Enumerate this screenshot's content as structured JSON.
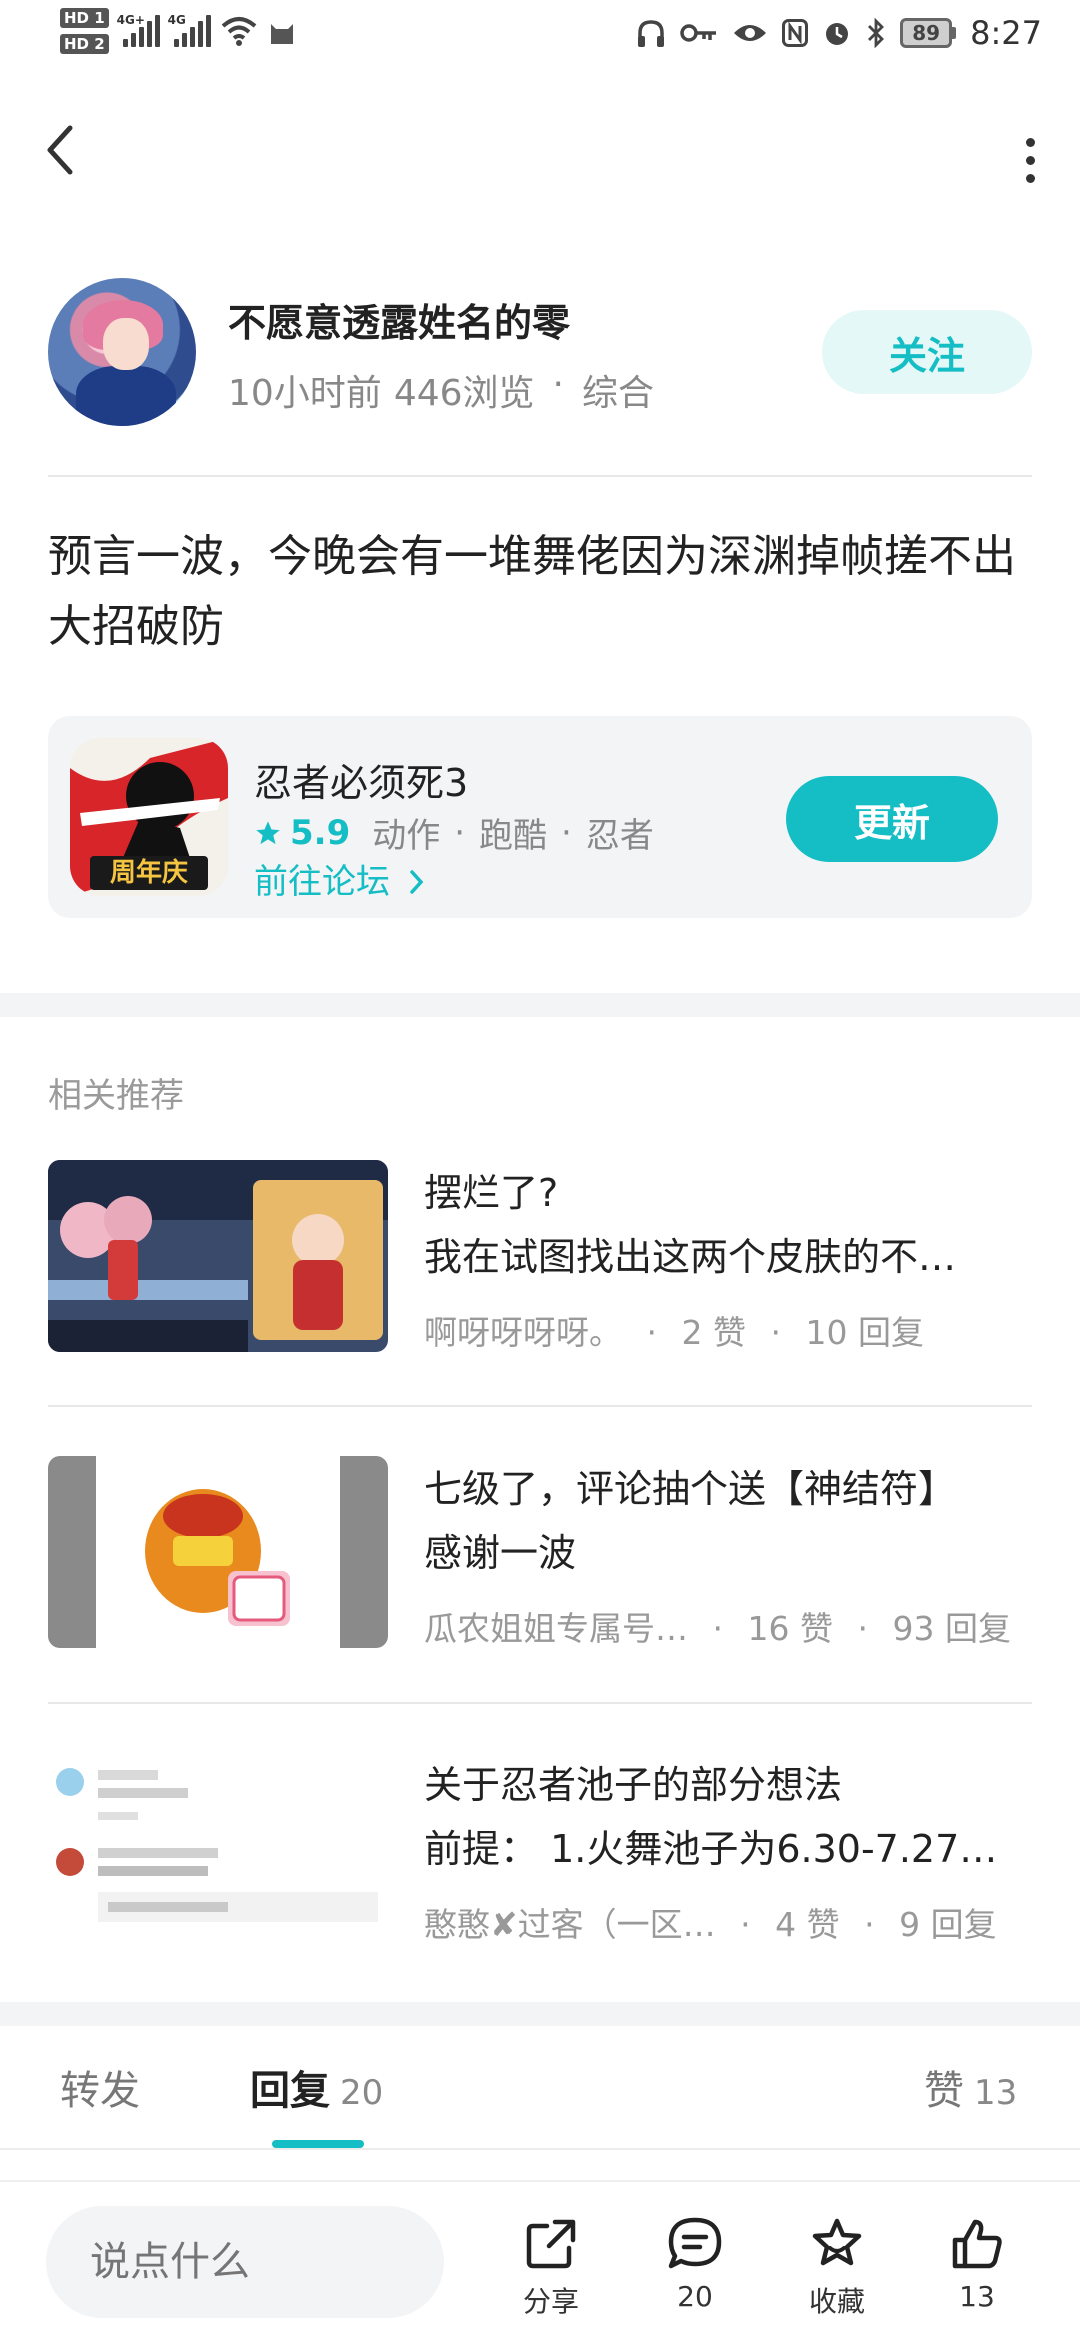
{
  "status_bar": {
    "hd1": "HD 1",
    "hd2": "HD 2",
    "net1": "4G+",
    "net2": "4G",
    "battery": "89",
    "time": "8:27"
  },
  "author": {
    "name": "不愿意透露姓名的零",
    "time_ago": "10小时前",
    "views": "446浏览",
    "separator": "·",
    "category": "综合",
    "follow_label": "关注"
  },
  "post": {
    "text": "预言一波，今晚会有一堆舞佬因为深渊掉帧搓不出大招破防"
  },
  "game": {
    "name": "忍者必须死3",
    "score": "5.9",
    "tags": [
      "动作",
      "跑酷",
      "忍者"
    ],
    "separator": "·",
    "forum_link": "前往论坛",
    "update_label": "更新",
    "icon_badge": "周年庆"
  },
  "related": {
    "title": "相关推荐",
    "items": [
      {
        "title1": "摆烂了?",
        "title2": "我在试图找出这两个皮肤的不…",
        "author": "啊呀呀呀呀。",
        "likes": "2 赞",
        "replies": "10 回复"
      },
      {
        "title1": "七级了，评论抽个送【神结符】",
        "title2": "感谢一波",
        "author": "瓜农姐姐专属号…",
        "likes": "16 赞",
        "replies": "93 回复"
      },
      {
        "title1": "关于忍者池子的部分想法",
        "title2": "前提：  1.火舞池子为6.30-7.27…",
        "author": "憨憨✘过客（一区…",
        "likes": "4 赞",
        "replies": "9 回复"
      }
    ]
  },
  "tabs": {
    "forward": "转发",
    "reply": "回复",
    "reply_count": "20",
    "like": "赞",
    "like_count": "13"
  },
  "bottom_bar": {
    "input_placeholder": "说点什么",
    "share_label": "分享",
    "comment_count": "20",
    "favorite_label": "收藏",
    "like_count": "13"
  },
  "colors": {
    "accent": "#15bdc4",
    "accent_light": "#e3f8f7",
    "card_bg": "#f3f4f6"
  }
}
